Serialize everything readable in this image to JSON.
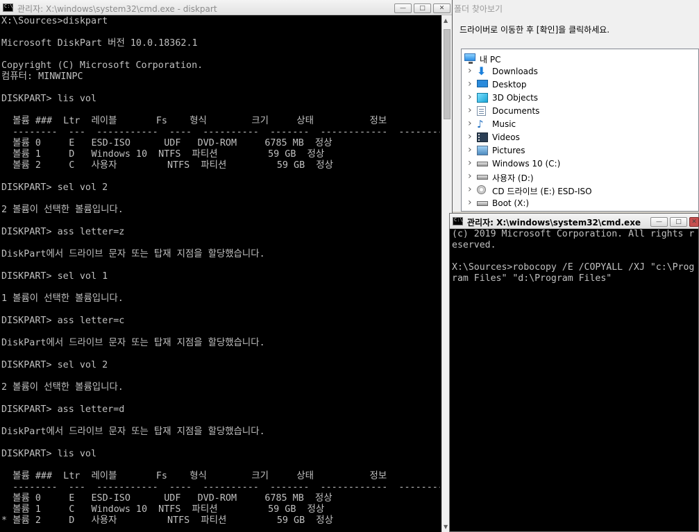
{
  "left_window": {
    "title": "관리자: X:\\windows\\system32\\cmd.exe - diskpart",
    "buttons": {
      "minimize": "—",
      "maximize": "□",
      "close": "✕"
    },
    "console_lines": [
      "X:\\Sources>diskpart",
      "",
      "Microsoft DiskPart 버전 10.0.18362.1",
      "",
      "Copyright (C) Microsoft Corporation.",
      "컴퓨터: MINWINPC",
      "",
      "DISKPART> lis vol",
      "",
      "  볼륨 ###  Ltr  레이블       Fs    형식        크기     상태          정보",
      "  --------  ---  -----------  ----  ----------  -------  ------------  --------",
      "  볼륨 0     E   ESD-ISO      UDF   DVD-ROM     6785 MB  정상",
      "  볼륨 1     D   Windows 10  NTFS  파티션         59 GB  정상",
      "  볼륨 2     C   사용자         NTFS  파티션         59 GB  정상",
      "",
      "DISKPART> sel vol 2",
      "",
      "2 볼륨이 선택한 볼륨입니다.",
      "",
      "DISKPART> ass letter=z",
      "",
      "DiskPart에서 드라이브 문자 또는 탑재 지점을 할당했습니다.",
      "",
      "DISKPART> sel vol 1",
      "",
      "1 볼륨이 선택한 볼륨입니다.",
      "",
      "DISKPART> ass letter=c",
      "",
      "DiskPart에서 드라이브 문자 또는 탑재 지점을 할당했습니다.",
      "",
      "DISKPART> sel vol 2",
      "",
      "2 볼륨이 선택한 볼륨입니다.",
      "",
      "DISKPART> ass letter=d",
      "",
      "DiskPart에서 드라이브 문자 또는 탑재 지점을 할당했습니다.",
      "",
      "DISKPART> lis vol",
      "",
      "  볼륨 ###  Ltr  레이블       Fs    형식        크기     상태          정보",
      "  --------  ---  -----------  ----  ----------  -------  ------------  --------",
      "  볼륨 0     E   ESD-ISO      UDF   DVD-ROM     6785 MB  정상",
      "  볼륨 1     C   Windows 10  NTFS  파티션         59 GB  정상",
      "* 볼륨 2     D   사용자         NTFS  파티션         59 GB  정상"
    ]
  },
  "folder_dialog": {
    "title": "폴더 찾아보기",
    "instruction": "드라이버로 이동한 후 [확인]을 클릭하세요.",
    "items": [
      {
        "label": "내 PC",
        "icon": "pc-icon",
        "expander": false
      },
      {
        "label": "Downloads",
        "icon": "downloads-icon",
        "expander": true
      },
      {
        "label": "Desktop",
        "icon": "desktop-icon",
        "expander": true
      },
      {
        "label": "3D Objects",
        "icon": "3d-objects-icon",
        "expander": true
      },
      {
        "label": "Documents",
        "icon": "documents-icon",
        "expander": true
      },
      {
        "label": "Music",
        "icon": "music-icon",
        "expander": true
      },
      {
        "label": "Videos",
        "icon": "videos-icon",
        "expander": true
      },
      {
        "label": "Pictures",
        "icon": "pictures-icon",
        "expander": true
      },
      {
        "label": "Windows 10 (C:)",
        "icon": "drive-icon",
        "expander": true
      },
      {
        "label": "사용자 (D:)",
        "icon": "drive-icon",
        "expander": true
      },
      {
        "label": "CD 드라이브 (E:) ESD-ISO",
        "icon": "cd-drive-icon",
        "expander": true
      },
      {
        "label": "Boot (X:)",
        "icon": "drive-icon",
        "expander": true
      }
    ]
  },
  "right_window": {
    "title": "관리자: X:\\windows\\system32\\cmd.exe",
    "buttons": {
      "minimize": "—",
      "maximize": "□",
      "close": "✕"
    },
    "console_lines": [
      "(c) 2019 Microsoft Corporation. All rights r",
      "eserved.",
      "",
      "X:\\Sources>robocopy /E /COPYALL /XJ \"c:\\Prog",
      "ram Files\" \"d:\\Program Files\""
    ]
  }
}
